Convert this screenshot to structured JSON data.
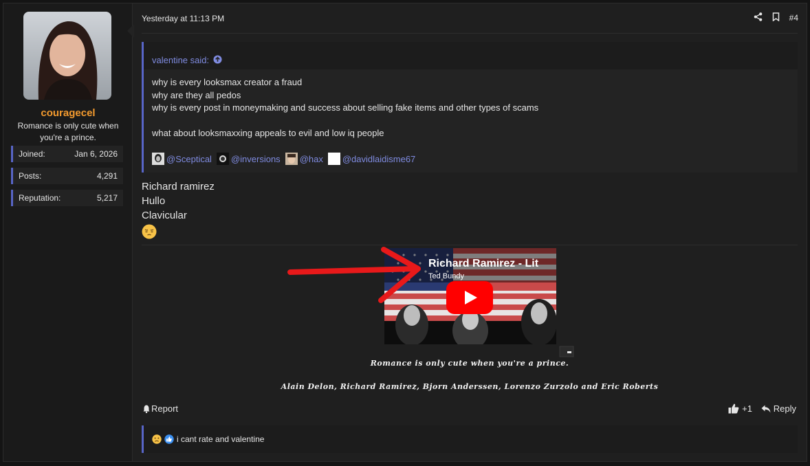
{
  "user": {
    "name": "couragecel",
    "title": "Romance is only cute when you're a prince.",
    "stats": [
      {
        "label": "Joined:",
        "value": "Jan 6, 2026"
      },
      {
        "label": "Posts:",
        "value": "4,291"
      },
      {
        "label": "Reputation:",
        "value": "5,217"
      }
    ]
  },
  "post": {
    "timestamp": "Yesterday at 11:13 PM",
    "number": "#4",
    "quote": {
      "author_line": "valentine said:",
      "lines": [
        "why is every looksmax creator a fraud",
        "why are they all pedos",
        "why is every post in moneymaking and success about selling fake items and other types of scams",
        "",
        "what about looksmaxxing appeals to evil and low iq people"
      ],
      "mentions": [
        "@Sceptical",
        "@inversions",
        "@hax",
        "@davidlaidisme67"
      ]
    },
    "body_lines": [
      "Richard ramirez",
      "Hullo",
      "Clavicular"
    ]
  },
  "signature": {
    "video_title": "Richard Ramirez - Lit",
    "video_channel": "Ted Bundy",
    "line1": "Romance is only cute when you're a prince.",
    "line2": "Alain Delon, Richard Ramirez, Bjorn Anderssen, Lorenzo Zurzolo and Eric Roberts"
  },
  "footer": {
    "report": "Report",
    "likes": "+1",
    "reply": "Reply"
  },
  "reactions": {
    "text": "i cant rate and valentine"
  },
  "colors": {
    "accent": "#5865c7",
    "username": "#f39a2e",
    "link": "#7f8be0"
  }
}
